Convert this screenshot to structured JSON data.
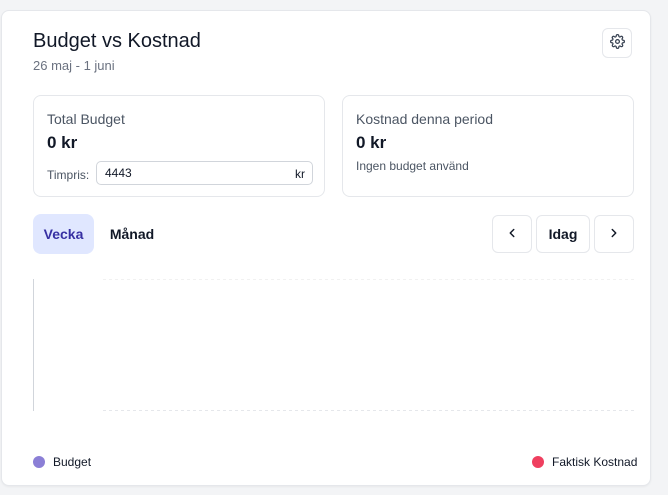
{
  "header": {
    "title": "Budget vs Kostnad",
    "date_range": "26 maj - 1 juni",
    "settings_icon": "gear-icon"
  },
  "stats": {
    "total_budget": {
      "label": "Total Budget",
      "value": "0 kr",
      "rate_label": "Timpris:",
      "rate_value": "4443",
      "rate_unit": "kr"
    },
    "period_cost": {
      "label": "Kostnad denna period",
      "value": "0 kr",
      "note": "Ingen budget använd"
    }
  },
  "tabs": [
    {
      "label": "Vecka",
      "active": true
    },
    {
      "label": "Månad",
      "active": false
    }
  ],
  "navigation": {
    "prev_icon": "chevron-left-icon",
    "today_label": "Idag",
    "next_icon": "chevron-right-icon"
  },
  "legend": [
    {
      "label": "Budget",
      "color": "#8b7fd6"
    },
    {
      "label": "Faktisk Kostnad",
      "color": "#ef3f5f"
    }
  ],
  "colors": {
    "accent_bg": "#e0e7ff",
    "accent_text": "#3730a3",
    "budget": "#8b7fd6",
    "actual": "#ef3f5f"
  }
}
